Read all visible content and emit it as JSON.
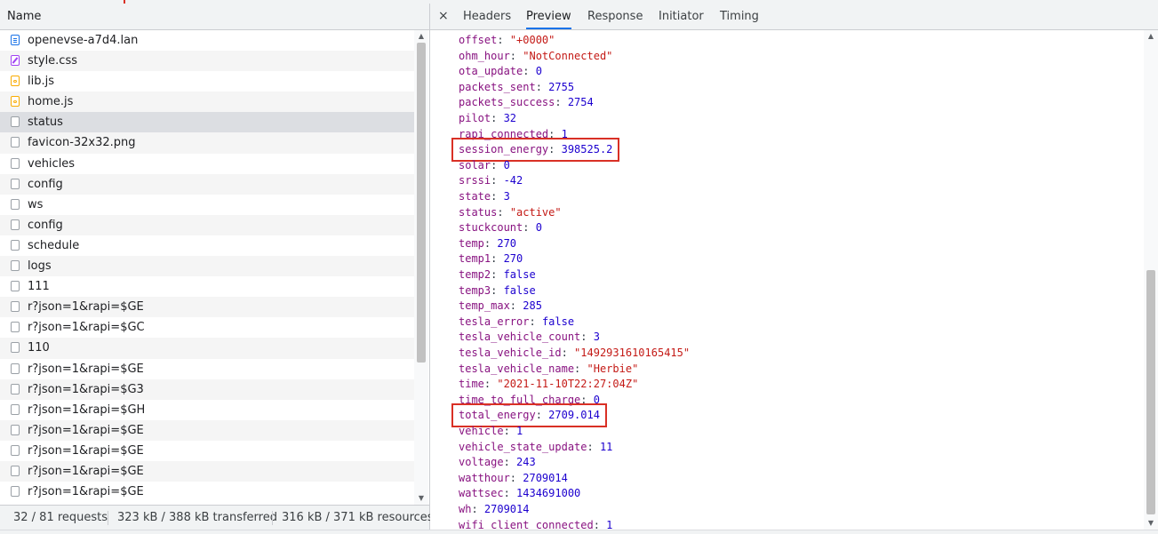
{
  "request_list": {
    "header": "Name",
    "items": [
      {
        "name": "openevse-a7d4.lan",
        "icon": "document-icon"
      },
      {
        "name": "style.css",
        "icon": "stylesheet-icon"
      },
      {
        "name": "lib.js",
        "icon": "script-icon"
      },
      {
        "name": "home.js",
        "icon": "script-icon"
      },
      {
        "name": "status",
        "icon": "file-icon",
        "selected": true
      },
      {
        "name": "favicon-32x32.png",
        "icon": "file-icon"
      },
      {
        "name": "vehicles",
        "icon": "file-icon"
      },
      {
        "name": "config",
        "icon": "file-icon"
      },
      {
        "name": "ws",
        "icon": "file-icon"
      },
      {
        "name": "config",
        "icon": "file-icon"
      },
      {
        "name": "schedule",
        "icon": "file-icon"
      },
      {
        "name": "logs",
        "icon": "file-icon"
      },
      {
        "name": "111",
        "icon": "file-icon"
      },
      {
        "name": "r?json=1&rapi=$GE",
        "icon": "file-icon"
      },
      {
        "name": "r?json=1&rapi=$GC",
        "icon": "file-icon"
      },
      {
        "name": "110",
        "icon": "file-icon"
      },
      {
        "name": "r?json=1&rapi=$GE",
        "icon": "file-icon"
      },
      {
        "name": "r?json=1&rapi=$G3",
        "icon": "file-icon"
      },
      {
        "name": "r?json=1&rapi=$GH",
        "icon": "file-icon"
      },
      {
        "name": "r?json=1&rapi=$GE",
        "icon": "file-icon"
      },
      {
        "name": "r?json=1&rapi=$GE",
        "icon": "file-icon"
      },
      {
        "name": "r?json=1&rapi=$GE",
        "icon": "file-icon"
      },
      {
        "name": "r?json=1&rapi=$GE",
        "icon": "file-icon"
      }
    ]
  },
  "summary": {
    "requests": "32 / 81 requests",
    "transferred": "323 kB / 388 kB transferred",
    "resources": "316 kB / 371 kB resources"
  },
  "detail_tabs": {
    "close_glyph": "×",
    "tabs": [
      "Headers",
      "Preview",
      "Response",
      "Initiator",
      "Timing"
    ],
    "active": "Preview"
  },
  "preview": {
    "lines": [
      {
        "key": "offset",
        "value": "\"+0000\"",
        "type": "string"
      },
      {
        "key": "ohm_hour",
        "value": "\"NotConnected\"",
        "type": "string"
      },
      {
        "key": "ota_update",
        "value": "0",
        "type": "number"
      },
      {
        "key": "packets_sent",
        "value": "2755",
        "type": "number"
      },
      {
        "key": "packets_success",
        "value": "2754",
        "type": "number"
      },
      {
        "key": "pilot",
        "value": "32",
        "type": "number"
      },
      {
        "key": "rapi_connected",
        "value": "1",
        "type": "number"
      },
      {
        "key": "session_energy",
        "value": "398525.2",
        "type": "number",
        "highlighted": true
      },
      {
        "key": "solar",
        "value": "0",
        "type": "number"
      },
      {
        "key": "srssi",
        "value": "-42",
        "type": "number"
      },
      {
        "key": "state",
        "value": "3",
        "type": "number"
      },
      {
        "key": "status",
        "value": "\"active\"",
        "type": "string"
      },
      {
        "key": "stuckcount",
        "value": "0",
        "type": "number"
      },
      {
        "key": "temp",
        "value": "270",
        "type": "number"
      },
      {
        "key": "temp1",
        "value": "270",
        "type": "number"
      },
      {
        "key": "temp2",
        "value": "false",
        "type": "bool"
      },
      {
        "key": "temp3",
        "value": "false",
        "type": "bool"
      },
      {
        "key": "temp_max",
        "value": "285",
        "type": "number"
      },
      {
        "key": "tesla_error",
        "value": "false",
        "type": "bool"
      },
      {
        "key": "tesla_vehicle_count",
        "value": "3",
        "type": "number"
      },
      {
        "key": "tesla_vehicle_id",
        "value": "\"1492931610165415\"",
        "type": "string"
      },
      {
        "key": "tesla_vehicle_name",
        "value": "\"Herbie\"",
        "type": "string"
      },
      {
        "key": "time",
        "value": "\"2021-11-10T22:27:04Z\"",
        "type": "string"
      },
      {
        "key": "time_to_full_charge",
        "value": "0",
        "type": "number"
      },
      {
        "key": "total_energy",
        "value": "2709.014",
        "type": "number",
        "highlighted": true
      },
      {
        "key": "vehicle",
        "value": "1",
        "type": "number"
      },
      {
        "key": "vehicle_state_update",
        "value": "11",
        "type": "number"
      },
      {
        "key": "voltage",
        "value": "243",
        "type": "number"
      },
      {
        "key": "watthour",
        "value": "2709014",
        "type": "number"
      },
      {
        "key": "wattsec",
        "value": "1434691000",
        "type": "number"
      },
      {
        "key": "wh",
        "value": "2709014",
        "type": "number"
      },
      {
        "key": "wifi_client_connected",
        "value": "1",
        "type": "number"
      }
    ]
  },
  "colors": {
    "highlight_border": "#d93025",
    "active_tab_underline": "#1a73e8",
    "json_key": "#881280",
    "json_number": "#1c00cf",
    "json_string": "#c41a16"
  }
}
